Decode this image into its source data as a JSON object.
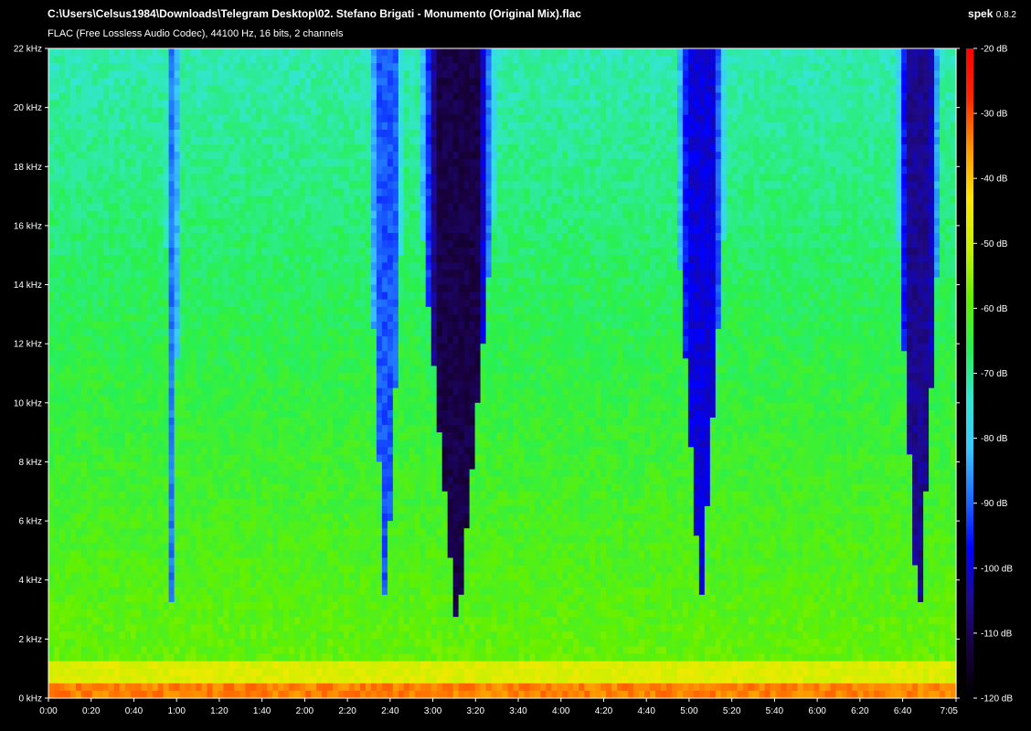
{
  "header": {
    "file_path": "C:\\Users\\Celsus1984\\Downloads\\Telegram Desktop\\02. Stefano Brigati - Monumento (Original Mix).flac",
    "stream_info": "FLAC (Free Lossless Audio Codec), 44100 Hz, 16 bits, 2 channels",
    "app_name": "spek",
    "app_version": "0.8.2"
  },
  "colors": {
    "background": "#000000",
    "text": "#ffffff",
    "palette": [
      "#000000",
      "#18003c",
      "#1e0a8c",
      "#0000ff",
      "#1e6cff",
      "#3cc8ff",
      "#32e6d2",
      "#28f050",
      "#64f000",
      "#c8f000",
      "#ffe600",
      "#ff9600",
      "#ff2800",
      "#ff0000"
    ]
  },
  "chart_data": {
    "type": "heatmap",
    "xlabel": "",
    "ylabel": "",
    "x_unit": "time",
    "x_range": [
      "0:00",
      "7:05"
    ],
    "x_ticks": [
      "0:00",
      "0:20",
      "0:40",
      "1:00",
      "1:20",
      "1:40",
      "2:00",
      "2:20",
      "2:40",
      "3:00",
      "3:20",
      "3:40",
      "4:00",
      "4:20",
      "4:40",
      "5:00",
      "5:20",
      "5:40",
      "6:00",
      "6:20",
      "6:40",
      "7:05"
    ],
    "x_tick_seconds": [
      0,
      20,
      40,
      60,
      80,
      100,
      120,
      140,
      160,
      180,
      200,
      220,
      240,
      260,
      280,
      300,
      320,
      340,
      360,
      380,
      400,
      425
    ],
    "duration_seconds": 425,
    "y_unit": "kHz",
    "ylim": [
      0,
      22
    ],
    "y_ticks": [
      "0 kHz",
      "2 kHz",
      "4 kHz",
      "6 kHz",
      "8 kHz",
      "10 kHz",
      "12 kHz",
      "14 kHz",
      "16 kHz",
      "18 kHz",
      "20 kHz",
      "22 kHz"
    ],
    "y_tick_values": [
      0,
      2,
      4,
      6,
      8,
      10,
      12,
      14,
      16,
      18,
      20,
      22
    ],
    "colorbar": {
      "labels": [
        "-20 dB",
        "-30 dB",
        "-40 dB",
        "-50 dB",
        "-60 dB",
        "-70 dB",
        "-80 dB",
        "-90 dB",
        "-100 dB",
        "-110 dB",
        "-120 dB"
      ],
      "values": [
        -20,
        -30,
        -40,
        -50,
        -60,
        -70,
        -80,
        -90,
        -100,
        -110,
        -120
      ],
      "range": [
        -120,
        -20
      ]
    },
    "breakdowns": [
      {
        "start_s": 54,
        "end_s": 62,
        "min_khz": 1.5,
        "depth": 0.55
      },
      {
        "start_s": 148,
        "end_s": 168,
        "min_khz": 2.5,
        "depth": 0.6
      },
      {
        "start_s": 170,
        "end_s": 213,
        "min_khz": 2.0,
        "depth": 0.97
      },
      {
        "start_s": 291,
        "end_s": 320,
        "min_khz": 3.0,
        "depth": 0.75
      },
      {
        "start_s": 395,
        "end_s": 420,
        "min_khz": 2.0,
        "depth": 0.85
      }
    ]
  }
}
